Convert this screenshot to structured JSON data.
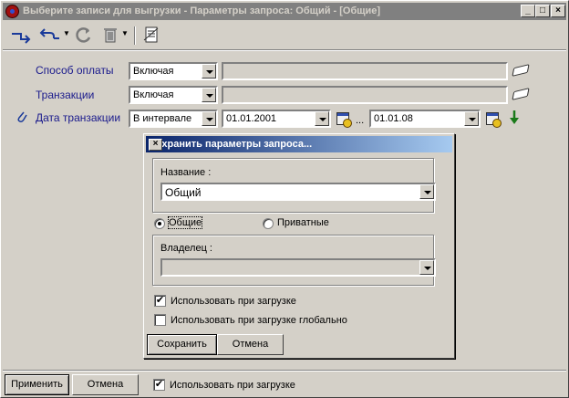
{
  "window": {
    "title": "Выберите записи для выгрузки - Параметры запроса: Общий - [Общие]",
    "controls": {
      "minimize": "_",
      "maximize": "□",
      "close": "×"
    }
  },
  "toolbar": {
    "icons": [
      "apply-arrow-icon",
      "undo-arrow-icon",
      "refresh-icon",
      "trash-icon",
      "query-params-icon"
    ]
  },
  "filters": {
    "payment": {
      "label": "Способ оплаты",
      "mode": "Включая",
      "value": ""
    },
    "transactions": {
      "label": "Транзакции",
      "mode": "Включая",
      "value": ""
    },
    "date": {
      "label": "Дата транзакции",
      "mode": "В интервале",
      "from": "01.01.2001",
      "range_sep": "...",
      "to": "01.01.08"
    }
  },
  "dialog": {
    "title": "Сохранить параметры запроса...",
    "close": "×",
    "name_label": "Название :",
    "name_value": "Общий",
    "radio_common": "Общие",
    "radio_private": "Приватные",
    "owner_label": "Владелец :",
    "owner_value": "",
    "use_on_load": "Использовать при загрузке",
    "use_on_load_global": "Использовать при загрузке глобально",
    "check_mark": "✔",
    "save": "Сохранить",
    "cancel": "Отмена"
  },
  "footer": {
    "apply": "Применить",
    "cancel": "Отмена",
    "use_on_load": "Использовать при загрузке",
    "check_mark": "✔"
  }
}
